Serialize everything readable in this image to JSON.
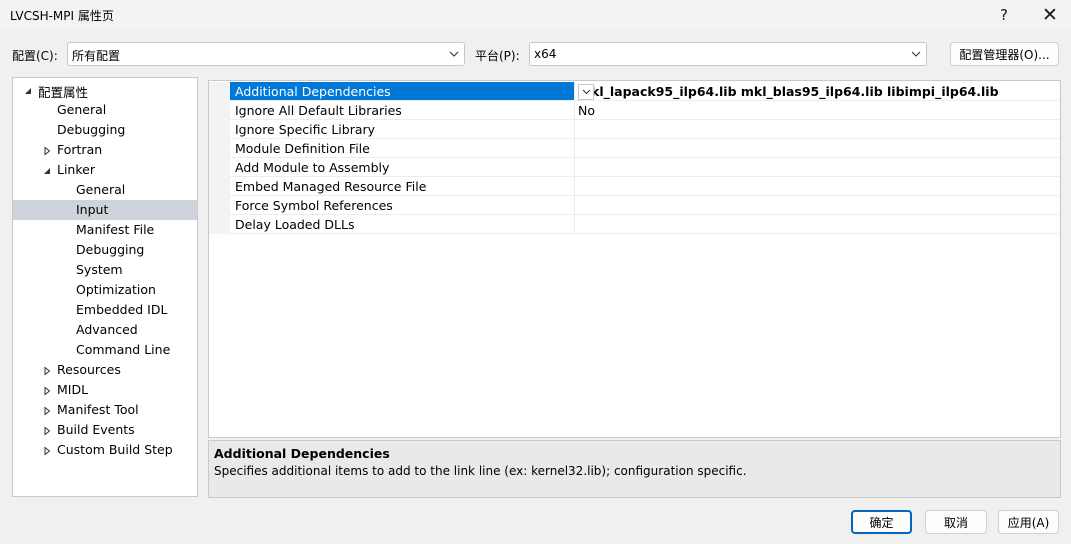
{
  "window": {
    "title": "LVCSH-MPI 属性页",
    "help_label": "?",
    "close_label": "✕"
  },
  "config_bar": {
    "config_label": "配置(C):",
    "config_value": "所有配置",
    "platform_label": "平台(P):",
    "platform_value": "x64",
    "manager_button": "配置管理器(O)..."
  },
  "tree": {
    "items": [
      {
        "label": "配置属性",
        "level": 0,
        "toggle": "expanded"
      },
      {
        "label": "General",
        "level": 1,
        "toggle": "none"
      },
      {
        "label": "Debugging",
        "level": 1,
        "toggle": "none"
      },
      {
        "label": "Fortran",
        "level": 1,
        "toggle": "collapsed"
      },
      {
        "label": "Linker",
        "level": 1,
        "toggle": "expanded"
      },
      {
        "label": "General",
        "level": 2,
        "toggle": "none"
      },
      {
        "label": "Input",
        "level": 2,
        "toggle": "none",
        "selected": true
      },
      {
        "label": "Manifest File",
        "level": 2,
        "toggle": "none"
      },
      {
        "label": "Debugging",
        "level": 2,
        "toggle": "none"
      },
      {
        "label": "System",
        "level": 2,
        "toggle": "none"
      },
      {
        "label": "Optimization",
        "level": 2,
        "toggle": "none"
      },
      {
        "label": "Embedded IDL",
        "level": 2,
        "toggle": "none"
      },
      {
        "label": "Advanced",
        "level": 2,
        "toggle": "none"
      },
      {
        "label": "Command Line",
        "level": 2,
        "toggle": "none"
      },
      {
        "label": "Resources",
        "level": 1,
        "toggle": "collapsed"
      },
      {
        "label": "MIDL",
        "level": 1,
        "toggle": "collapsed"
      },
      {
        "label": "Manifest Tool",
        "level": 1,
        "toggle": "collapsed"
      },
      {
        "label": "Build Events",
        "level": 1,
        "toggle": "collapsed"
      },
      {
        "label": "Custom Build Step",
        "level": 1,
        "toggle": "collapsed"
      }
    ]
  },
  "properties": {
    "rows": [
      {
        "name": "Additional Dependencies",
        "value": "mkl_lapack95_ilp64.lib mkl_blas95_ilp64.lib libimpi_ilp64.lib",
        "selected": true,
        "bold": true
      },
      {
        "name": "Ignore All Default Libraries",
        "value": "No",
        "selected": false,
        "bold": false
      },
      {
        "name": "Ignore Specific Library",
        "value": "",
        "selected": false,
        "bold": false
      },
      {
        "name": "Module Definition File",
        "value": "",
        "selected": false,
        "bold": false
      },
      {
        "name": "Add Module to Assembly",
        "value": "",
        "selected": false,
        "bold": false
      },
      {
        "name": "Embed Managed Resource File",
        "value": "",
        "selected": false,
        "bold": false
      },
      {
        "name": "Force Symbol References",
        "value": "",
        "selected": false,
        "bold": false
      },
      {
        "name": "Delay Loaded DLLs",
        "value": "",
        "selected": false,
        "bold": false
      }
    ]
  },
  "description": {
    "title": "Additional Dependencies",
    "text": "Specifies additional items to add to the link line (ex: kernel32.lib); configuration specific."
  },
  "footer": {
    "ok": "确定",
    "cancel": "取消",
    "apply": "应用(A)"
  },
  "colors": {
    "selection_blue": "#0078d7",
    "tree_selection": "#cfd3dc",
    "accent_border": "#0067c0"
  }
}
